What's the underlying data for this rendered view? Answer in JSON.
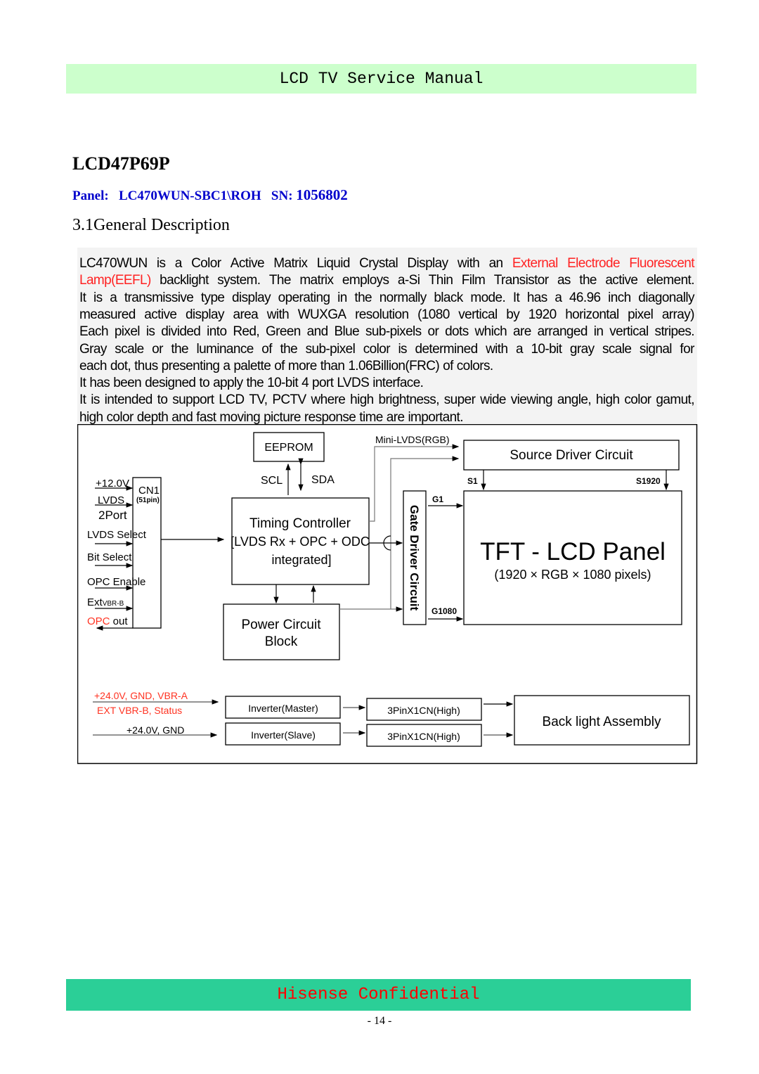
{
  "header": {
    "title": "LCD TV Service Manual"
  },
  "model": "LCD47P69P",
  "panel": {
    "label": "Panel:",
    "value": "LC470WUN-SBC1\\ROH",
    "sn_label": "SN:",
    "sn_value": "1056802"
  },
  "section_title": "3.1General Description",
  "description_lines": [
    [
      {
        "t": "LC470WUN is a Color Active Matrix Liquid Crystal Display with an "
      },
      {
        "t": "External Electrode Fluorescent",
        "red": true
      }
    ],
    [
      {
        "t": "Lamp(EEFL)",
        "red": true
      },
      {
        "t": " backlight system. The matrix employs a-Si Thin Film Transistor as the active element."
      }
    ],
    [
      {
        "t": "It is a transmissive type display operating in the normally black mode. It has a 46.96 inch  diagonally"
      }
    ],
    [
      {
        "t": "measured active display area with WUXGA resolution (1080 vertical by 1920 horizontal pixel array)"
      }
    ],
    [
      {
        "t": "Each pixel is divided into Red, Green and Blue sub-pixels or dots which are arranged in vertical stripes."
      }
    ],
    [
      {
        "t": "Gray scale or the luminance of the sub-pixel color is determined with a 10-bit gray scale signal for"
      }
    ],
    [
      {
        "t": "each dot, thus presenting a palette of more than 1.06Billion(FRC) of colors."
      }
    ],
    [
      {
        "t": "It has been designed to apply the 10-bit 4 port LVDS interface."
      }
    ],
    [
      {
        "t": "It is intended to support LCD TV, PCTV where high brightness, super wide viewing angle, high color gamut,"
      }
    ],
    [
      {
        "t": "high color depth and fast moving picture response time are important."
      }
    ]
  ],
  "diagram": {
    "eeprom": "EEPROM",
    "scl": "SCL",
    "sda": "SDA",
    "mini_lvds": "Mini-LVDS(RGB)",
    "source_driver": "Source Driver Circuit",
    "s1": "S1",
    "s1920": "S1920",
    "g1": "G1",
    "g1080": "G1080",
    "gate_driver": "Gate Driver Circuit",
    "tft_title": "TFT - LCD Panel",
    "tft_sub": "(1920 × RGB × 1080 pixels)",
    "tcon_1": "Timing Controller",
    "tcon_2": "[LVDS Rx + OPC + ODC",
    "tcon_3": "integrated]",
    "power_1": "Power Circuit",
    "power_2": "Block",
    "cn1": "CN1",
    "cn1_pins": "(51pin)",
    "inputs": {
      "v12": "+12.0V",
      "lvds": "LVDS",
      "port": "2Port",
      "lvds_select": "LVDS Select",
      "bit_select": "Bit Select",
      "opc_enable": "OPC Enable",
      "extvbr_main": "Ext",
      "extvbr_sub": "VBR-B",
      "opc_red": "OPC",
      "opc_out": " out"
    },
    "inv_in_1": "+24.0V, GND, VBR-A",
    "inv_in_2": "EXT VBR-B, Status",
    "inv_in_3": "+24.0V, GND",
    "inv_master": "Inverter(Master)",
    "inv_slave": "Inverter(Slave)",
    "conn_1": "3PinX1CN(High)",
    "conn_2": "3PinX1CN(High)",
    "backlight": "Back light Assembly",
    "colors": {
      "red": "#ff3322",
      "line": "#000000",
      "gray_line": "#777777"
    }
  },
  "footer": {
    "text": "Hisense Confidential",
    "page": "- 14 -"
  }
}
